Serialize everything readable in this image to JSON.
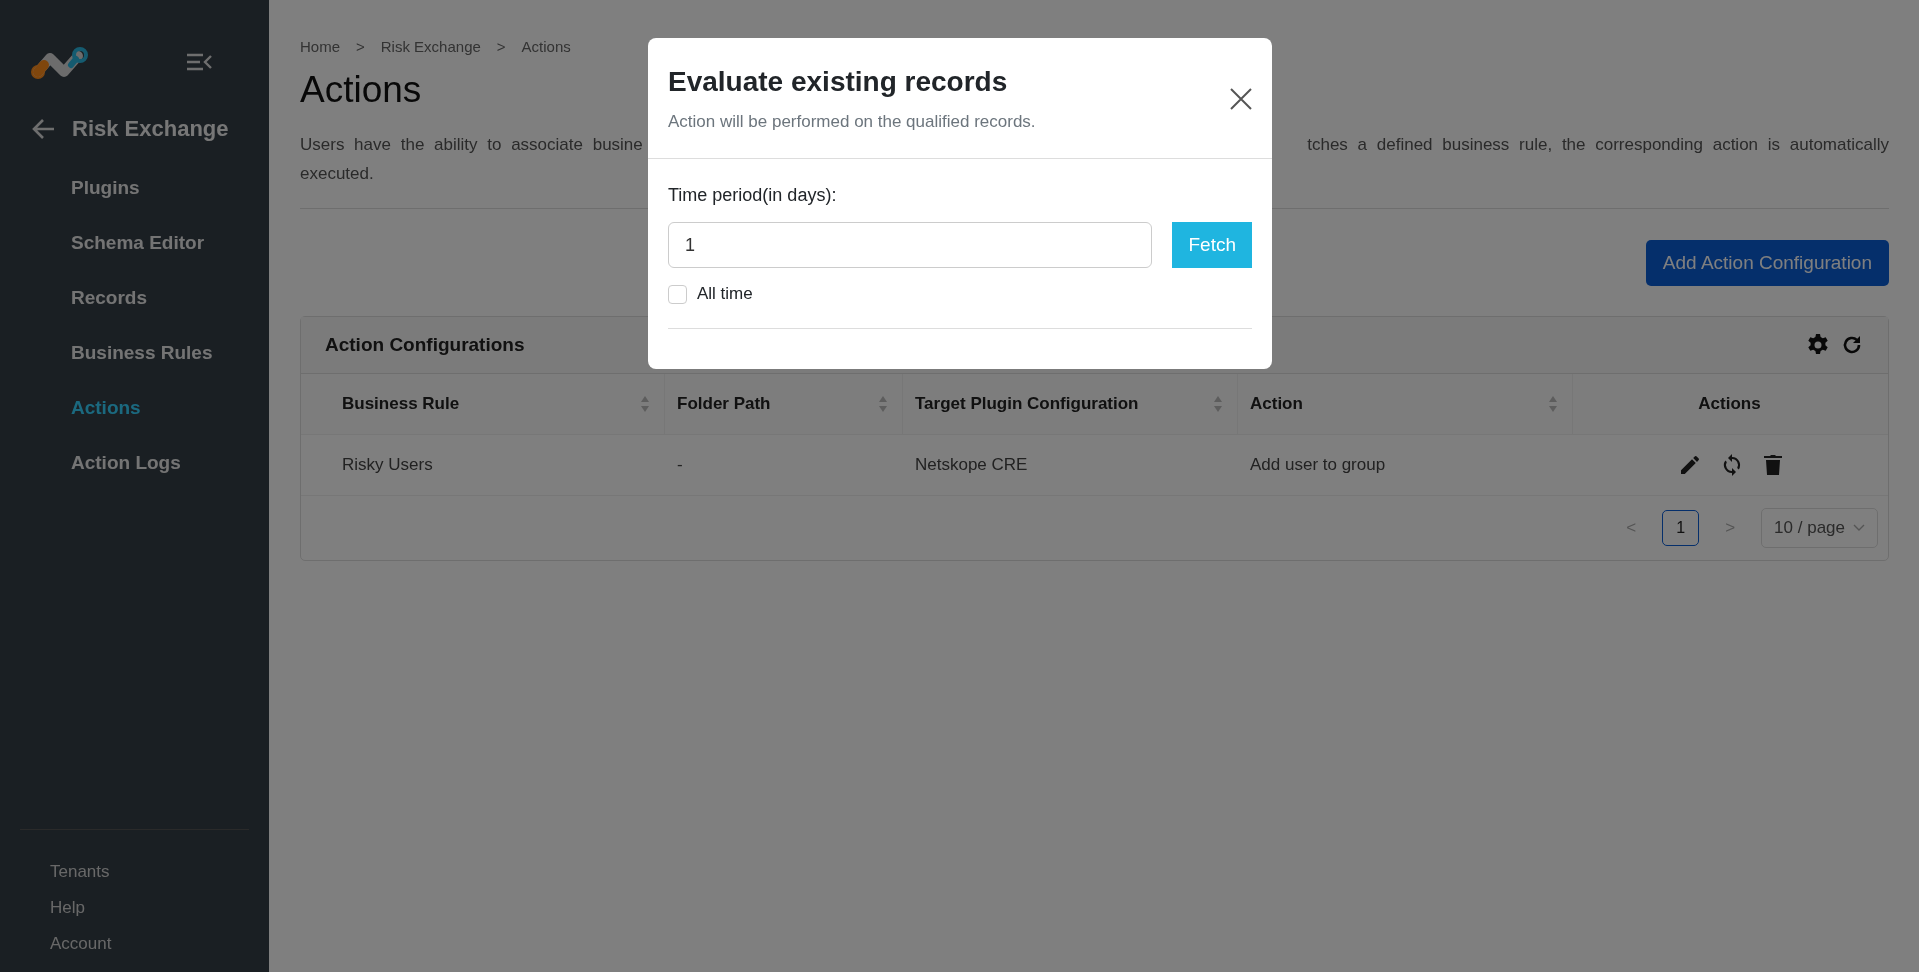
{
  "sidebar": {
    "title": "Risk Exchange",
    "items": [
      {
        "label": "Plugins",
        "selected": false
      },
      {
        "label": "Schema Editor",
        "selected": false
      },
      {
        "label": "Records",
        "selected": false
      },
      {
        "label": "Business Rules",
        "selected": false
      },
      {
        "label": "Actions",
        "selected": true
      },
      {
        "label": "Action Logs",
        "selected": false
      }
    ],
    "footer_items": [
      "Tenants",
      "Help",
      "Account"
    ]
  },
  "breadcrumb": [
    "Home",
    ">",
    "Risk Exchange",
    ">",
    "Actions"
  ],
  "page": {
    "title": "Actions",
    "description_left": "Users have the ability to associate busine",
    "description_right": "tches a defined business rule, the corresponding action is automatically",
    "description_end": "executed."
  },
  "add_button": "Add Action Configuration",
  "card": {
    "title": "Action Configurations",
    "columns": [
      {
        "label": "Business Rule",
        "sortable": true
      },
      {
        "label": "Folder Path",
        "sortable": true
      },
      {
        "label": "Target Plugin Configuration",
        "sortable": true
      },
      {
        "label": "Action",
        "sortable": true
      },
      {
        "label": "Actions",
        "sortable": false
      }
    ],
    "rows": [
      [
        "Risky Users",
        "-",
        "Netskope CRE",
        "Add user to group"
      ]
    ],
    "pagination": {
      "prev": "<",
      "next": ">",
      "pages": [
        {
          "label": "1",
          "selected": true
        }
      ],
      "page_size": "10 / page"
    }
  },
  "modal": {
    "title": "Evaluate existing records",
    "subtitle": "Action will be performed on the qualified records.",
    "field_label": "Time period(in days):",
    "value": "1",
    "button": "Fetch",
    "checkbox": {
      "label": "All time",
      "checked": false
    }
  }
}
